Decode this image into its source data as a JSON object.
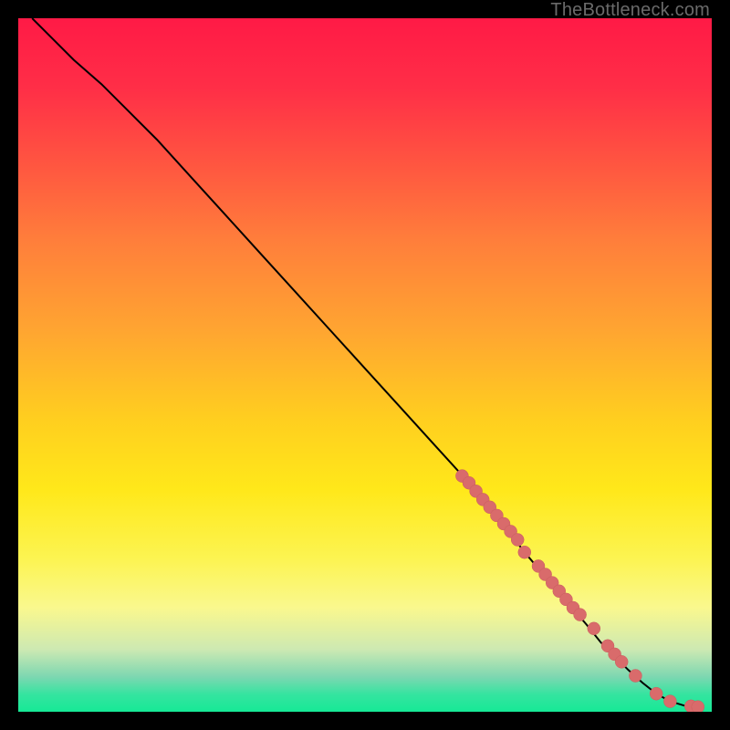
{
  "watermark": "TheBottleneck.com",
  "chart_data": {
    "type": "line",
    "title": "",
    "xlabel": "",
    "ylabel": "",
    "xlim": [
      0,
      100
    ],
    "ylim": [
      0,
      100
    ],
    "curve": {
      "x": [
        2,
        5,
        8,
        12,
        16,
        20,
        25,
        30,
        35,
        40,
        45,
        50,
        55,
        60,
        65,
        70,
        73,
        76,
        79,
        82,
        84,
        86,
        88,
        90,
        92,
        94,
        96,
        98
      ],
      "y": [
        100,
        97,
        94,
        90.5,
        86.5,
        82.5,
        77,
        71.5,
        66,
        60.5,
        55,
        49.5,
        44,
        38.5,
        33,
        27,
        23,
        19.5,
        16,
        12.5,
        10,
        8,
        6,
        4.2,
        2.6,
        1.5,
        0.9,
        0.7
      ]
    },
    "markers": {
      "x": [
        64,
        65,
        66,
        67,
        68,
        69,
        70,
        71,
        72,
        73,
        75,
        76,
        77,
        78,
        79,
        80,
        81,
        83,
        85,
        86,
        87,
        89,
        92,
        94,
        97,
        98
      ],
      "y": [
        34,
        33,
        31.8,
        30.6,
        29.5,
        28.3,
        27.1,
        26,
        24.8,
        23,
        21,
        19.8,
        18.6,
        17.4,
        16.2,
        15,
        14,
        12,
        9.5,
        8.3,
        7.2,
        5.2,
        2.6,
        1.5,
        0.8,
        0.7
      ]
    },
    "dot_radius_px": 7
  }
}
